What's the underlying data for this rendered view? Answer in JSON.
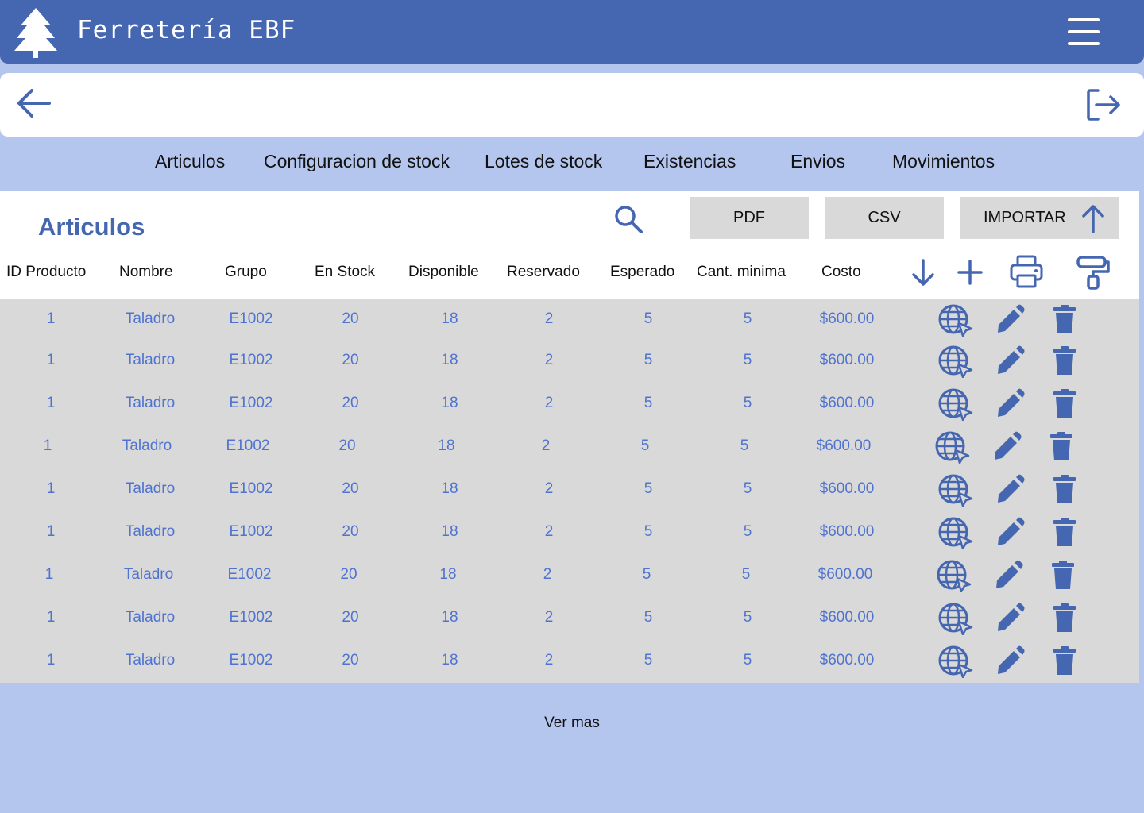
{
  "app": {
    "title": "Ferretería EBF"
  },
  "icons": {
    "logo": "tree-icon",
    "menu": "hamburger-menu-icon",
    "back": "arrow-left-icon",
    "logout": "logout-icon",
    "search": "search-icon",
    "import": "arrow-up-icon",
    "sort": "arrow-down-icon",
    "add": "plus-icon",
    "print": "printer-icon",
    "paint": "paint-roller-icon",
    "web": "globe-cursor-icon",
    "edit": "pencil-icon",
    "delete": "trash-icon"
  },
  "colors": {
    "primary": "#4566b0",
    "background": "#b4c5ee",
    "row_bg": "#d9d9d9",
    "cell_text": "#4f73d0"
  },
  "tabs": [
    "Articulos",
    "Configuracion de stock",
    "Lotes de stock",
    "Existencias",
    "Envios",
    "Movimientos"
  ],
  "panel": {
    "title": "Articulos"
  },
  "buttons": {
    "pdf": "PDF",
    "csv": "CSV",
    "import": "IMPORTAR"
  },
  "table": {
    "headers": [
      "ID Producto",
      "Nombre",
      "Grupo",
      "En Stock",
      "Disponible",
      "Reservado",
      "Esperado",
      "Cant. minima",
      "Costo"
    ],
    "rows": [
      [
        "1",
        "Taladro",
        "E1002",
        "20",
        "18",
        "2",
        "5",
        "5",
        "$600.00"
      ],
      [
        "1",
        "Taladro",
        "E1002",
        "20",
        "18",
        "2",
        "5",
        "5",
        "$600.00"
      ],
      [
        "1",
        "Taladro",
        "E1002",
        "20",
        "18",
        "2",
        "5",
        "5",
        "$600.00"
      ],
      [
        "1",
        "Taladro",
        "E1002",
        "20",
        "18",
        "2",
        "5",
        "5",
        "$600.00"
      ],
      [
        "1",
        "Taladro",
        "E1002",
        "20",
        "18",
        "2",
        "5",
        "5",
        "$600.00"
      ],
      [
        "1",
        "Taladro",
        "E1002",
        "20",
        "18",
        "2",
        "5",
        "5",
        "$600.00"
      ],
      [
        "1",
        "Taladro",
        "E1002",
        "20",
        "18",
        "2",
        "5",
        "5",
        "$600.00"
      ],
      [
        "1",
        "Taladro",
        "E1002",
        "20",
        "18",
        "2",
        "5",
        "5",
        "$600.00"
      ],
      [
        "1",
        "Taladro",
        "E1002",
        "20",
        "18",
        "2",
        "5",
        "5",
        "$600.00"
      ]
    ]
  },
  "footer": {
    "more_label": "Ver mas"
  }
}
